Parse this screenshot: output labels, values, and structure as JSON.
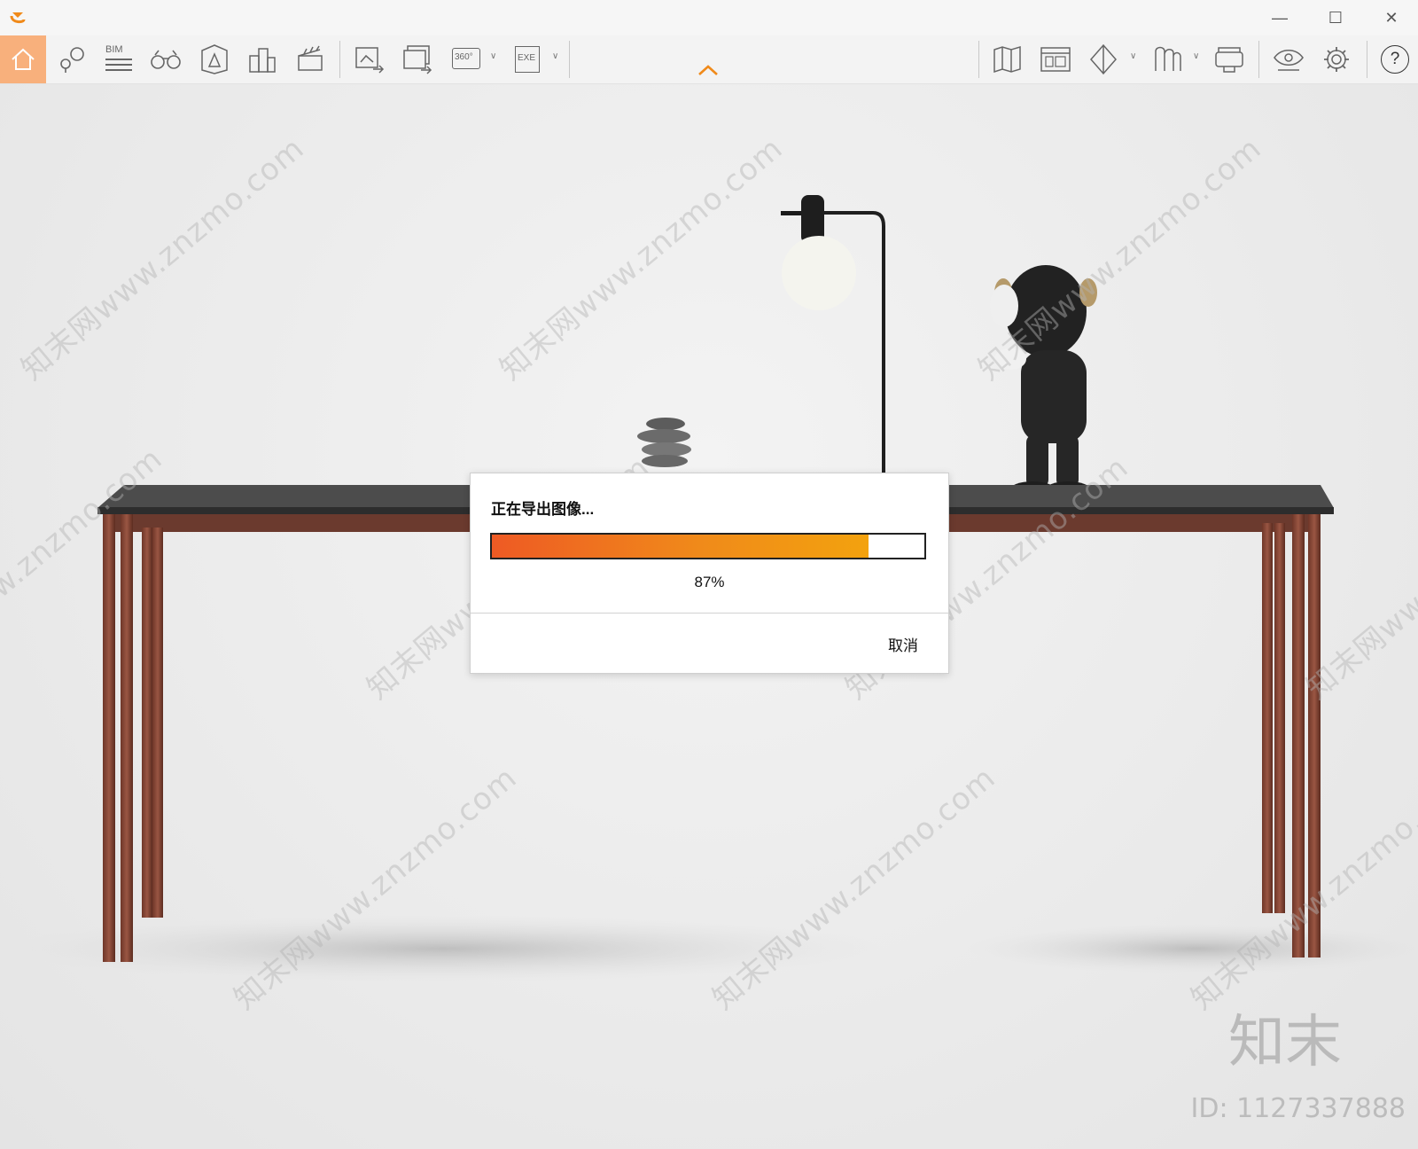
{
  "window": {
    "minimize_glyph": "—",
    "maximize_glyph": "☐",
    "close_glyph": "✕"
  },
  "toolbar": {
    "bim_label": "BIM",
    "panorama_label": "360°",
    "exe_label": "EXE",
    "help_glyph": "?",
    "accent_color": "#f08a1a",
    "home_active_bg": "#f8b07c",
    "icons": [
      "home-icon",
      "location-icon",
      "bim-icon",
      "binoculars-icon",
      "scene-icon",
      "buildings-icon",
      "clapperboard-icon",
      "export-image-icon",
      "export-batch-icon",
      "export-panorama-icon",
      "export-exe-icon",
      "map-icon",
      "layout-icon",
      "cube-icon",
      "model-icon",
      "vr-headset-icon",
      "eye-icon",
      "gear-icon",
      "help-icon"
    ]
  },
  "dialog": {
    "title": "正在导出图像...",
    "progress_value": 0.87,
    "progress_text": "87%",
    "cancel_label": "取消"
  },
  "watermark": {
    "text": "知末网www.znzmo.com",
    "brand": "知末",
    "id_text": "ID: 1127337888"
  }
}
